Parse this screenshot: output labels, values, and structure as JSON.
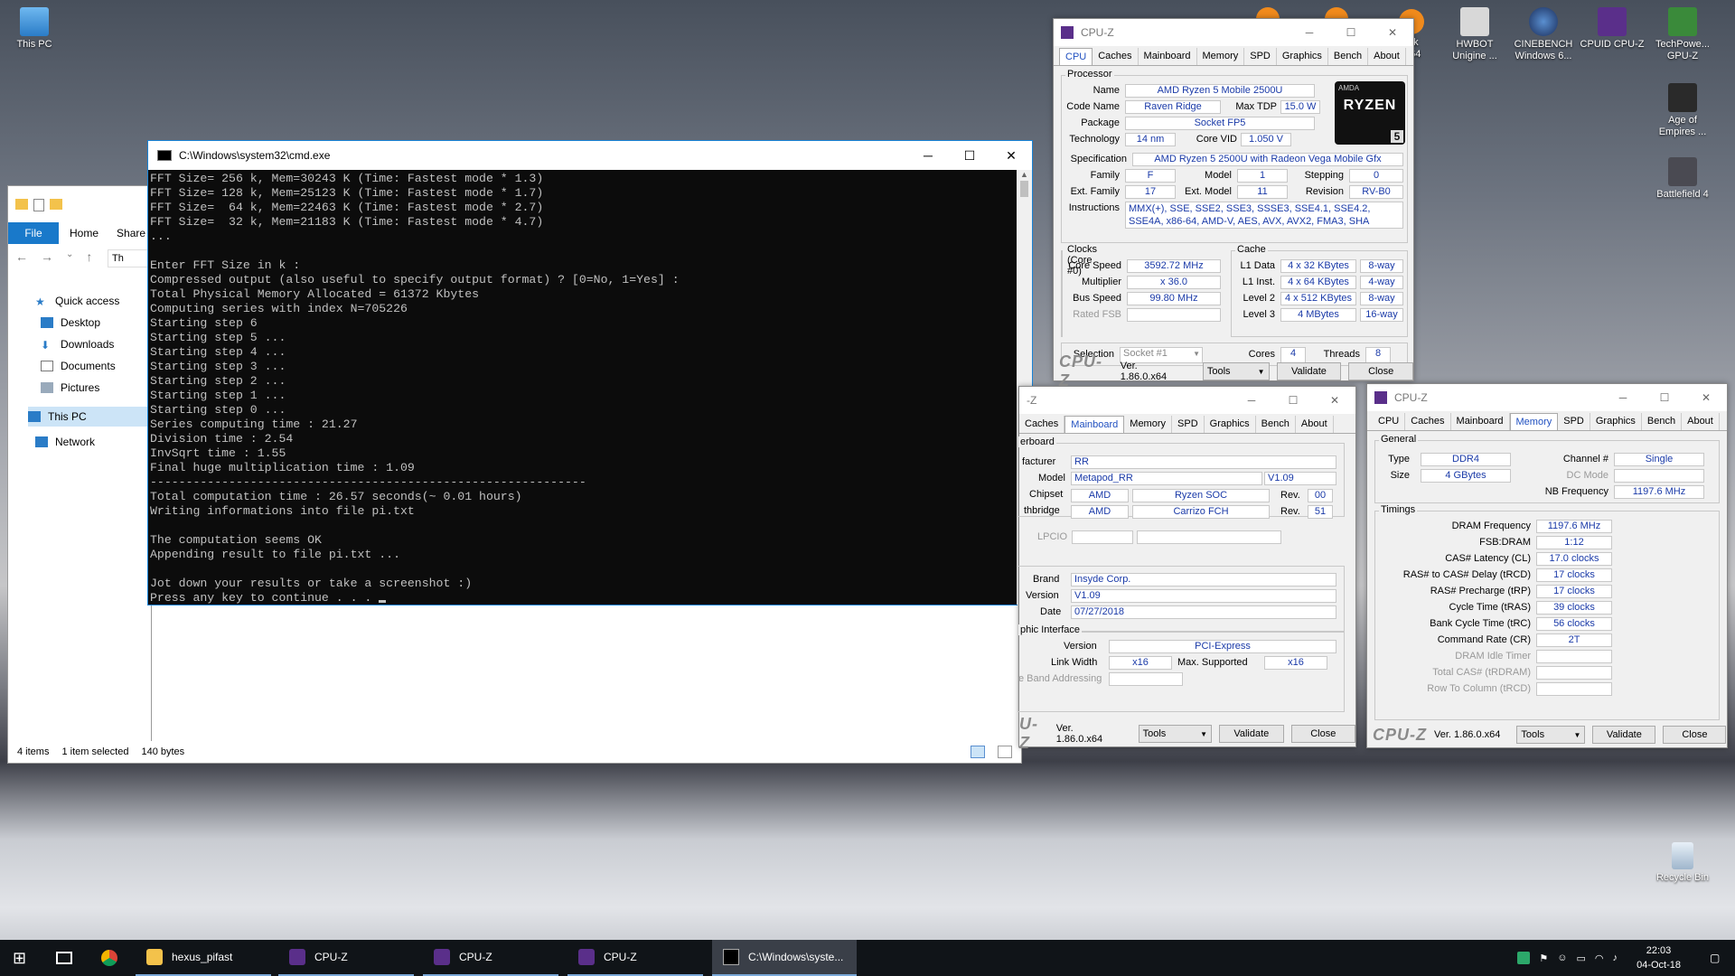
{
  "desktop": {
    "icons_left": [
      {
        "label": "This PC"
      }
    ],
    "icons_right": [
      {
        "label": "ark\n.x64"
      },
      {
        "label": "HWBOT\nUnigine ..."
      },
      {
        "label": "CINEBENCH\nWindows 6..."
      },
      {
        "label": "CPUID CPU-Z"
      },
      {
        "label": "TechPowe...\nGPU-Z"
      },
      {
        "label": "Age of\nEmpires ..."
      },
      {
        "label": "Battlefield 4"
      },
      {
        "label": "Recycle Bin"
      }
    ]
  },
  "explorer": {
    "tab_file": "File",
    "tab_home": "Home",
    "tab_share": "Share",
    "address": "Th",
    "nav": [
      "Quick access",
      "Desktop",
      "Downloads",
      "Documents",
      "Pictures",
      "This PC",
      "Network"
    ],
    "status": {
      "items": "4 items",
      "selected": "1 item selected",
      "size": "140 bytes"
    }
  },
  "cmd": {
    "title": "C:\\Windows\\system32\\cmd.exe",
    "lines": [
      "FFT Size= 256 k, Mem=30243 K (Time: Fastest mode * 1.3)",
      "FFT Size= 128 k, Mem=25123 K (Time: Fastest mode * 1.7)",
      "FFT Size=  64 k, Mem=22463 K (Time: Fastest mode * 2.7)",
      "FFT Size=  32 k, Mem=21183 K (Time: Fastest mode * 4.7)",
      "...",
      "",
      "Enter FFT Size in k :",
      "Compressed output (also useful to specify output format) ? [0=No, 1=Yes] :",
      "Total Physical Memory Allocated = 61372 Kbytes",
      "Computing series with index N=705226",
      "Starting step 6",
      "Starting step 5 ...",
      "Starting step 4 ...",
      "Starting step 3 ...",
      "Starting step 2 ...",
      "Starting step 1 ...",
      "Starting step 0 ...",
      "Series computing time : 21.27",
      "Division time : 2.54",
      "InvSqrt time : 1.55",
      "Final huge multiplication time : 1.09",
      "-------------------------------------------------------------",
      "Total computation time : 26.57 seconds(~ 0.01 hours)",
      "Writing informations into file pi.txt",
      "",
      "The computation seems OK",
      "Appending result to file pi.txt ...",
      "",
      "Jot down your results or take a screenshot :)",
      "Press any key to continue . . . "
    ]
  },
  "cpuz_cpu": {
    "title": "CPU-Z",
    "tabs": [
      "CPU",
      "Caches",
      "Mainboard",
      "Memory",
      "SPD",
      "Graphics",
      "Bench",
      "About"
    ],
    "processor_group": "Processor",
    "name_l": "Name",
    "name": "AMD Ryzen 5 Mobile 2500U",
    "code_name_l": "Code Name",
    "code_name": "Raven Ridge",
    "max_tdp_l": "Max TDP",
    "max_tdp": "15.0 W",
    "package_l": "Package",
    "package": "Socket FP5",
    "technology_l": "Technology",
    "technology": "14 nm",
    "core_vid_l": "Core VID",
    "core_vid": "1.050 V",
    "specification_l": "Specification",
    "specification": "AMD Ryzen 5 2500U with Radeon Vega Mobile Gfx",
    "family_l": "Family",
    "family": "F",
    "model_l": "Model",
    "model": "1",
    "stepping_l": "Stepping",
    "stepping": "0",
    "ext_family_l": "Ext. Family",
    "ext_family": "17",
    "ext_model_l": "Ext. Model",
    "ext_model": "11",
    "revision_l": "Revision",
    "revision": "RV-B0",
    "instructions_l": "Instructions",
    "instructions": "MMX(+), SSE, SSE2, SSE3, SSSE3, SSE4.1, SSE4.2, SSE4A, x86-64, AMD-V, AES, AVX, AVX2, FMA3, SHA",
    "logo_small": "AMDA",
    "logo": "RYZEN",
    "logo_num": "5",
    "clocks_group": "Clocks (Core #0)",
    "core_speed_l": "Core Speed",
    "core_speed": "3592.72 MHz",
    "multiplier_l": "Multiplier",
    "multiplier": "x 36.0",
    "bus_speed_l": "Bus Speed",
    "bus_speed": "99.80 MHz",
    "rated_fsb_l": "Rated FSB",
    "cache_group": "Cache",
    "l1d_l": "L1 Data",
    "l1d": "4 x 32 KBytes",
    "l1d_w": "8-way",
    "l1i_l": "L1 Inst.",
    "l1i": "4 x 64 KBytes",
    "l1i_w": "4-way",
    "l2_l": "Level 2",
    "l2": "4 x 512 KBytes",
    "l2_w": "8-way",
    "l3_l": "Level 3",
    "l3": "4 MBytes",
    "l3_w": "16-way",
    "selection_l": "Selection",
    "selection": "Socket #1",
    "cores_l": "Cores",
    "cores": "4",
    "threads_l": "Threads",
    "threads": "8",
    "logo_text": "CPU-Z",
    "version": "Ver. 1.86.0.x64",
    "tools": "Tools",
    "validate": "Validate",
    "close": "Close"
  },
  "cpuz_mb": {
    "title": "-Z",
    "tabs": [
      "Caches",
      "Mainboard",
      "Memory",
      "SPD",
      "Graphics",
      "Bench",
      "About"
    ],
    "group_mb": "erboard",
    "manufacturer_l": "facturer",
    "manufacturer": "RR",
    "model_l": "Model",
    "model": "Metapod_RR",
    "model_rev": "V1.09",
    "chipset_l": "Chipset",
    "chipset": "AMD",
    "chipset2": "Ryzen SOC",
    "chipset_rev_l": "Rev.",
    "chipset_rev": "00",
    "south_l": "thbridge",
    "south": "AMD",
    "south2": "Carrizo FCH",
    "south_rev_l": "Rev.",
    "south_rev": "51",
    "lpcio_l": "LPCIO",
    "brand_l": "Brand",
    "brand": "Insyde Corp.",
    "version_l": "Version",
    "version_v": "V1.09",
    "date_l": "Date",
    "date": "07/27/2018",
    "group_gi": "phic Interface",
    "gi_version_l": "Version",
    "gi_version": "PCI-Express",
    "link_width_l": "Link Width",
    "link_width": "x16",
    "max_supported_l": "Max. Supported",
    "max_supported": "x16",
    "band_l": "e Band Addressing",
    "logo_text": "U-Z",
    "version": "Ver. 1.86.0.x64",
    "tools": "Tools",
    "validate": "Validate",
    "close": "Close"
  },
  "cpuz_mem": {
    "title": "CPU-Z",
    "tabs": [
      "CPU",
      "Caches",
      "Mainboard",
      "Memory",
      "SPD",
      "Graphics",
      "Bench",
      "About"
    ],
    "general_group": "General",
    "type_l": "Type",
    "type": "DDR4",
    "channel_l": "Channel #",
    "channel": "Single",
    "size_l": "Size",
    "size": "4 GBytes",
    "dc_mode_l": "DC Mode",
    "nb_freq_l": "NB Frequency",
    "nb_freq": "1197.6 MHz",
    "timings_group": "Timings",
    "dram_freq_l": "DRAM Frequency",
    "dram_freq": "1197.6 MHz",
    "fsb_dram_l": "FSB:DRAM",
    "fsb_dram": "1:12",
    "cas_l": "CAS# Latency (CL)",
    "cas": "17.0 clocks",
    "trcd_l": "RAS# to CAS# Delay (tRCD)",
    "trcd": "17 clocks",
    "trp_l": "RAS# Precharge (tRP)",
    "trp": "17 clocks",
    "tras_l": "Cycle Time (tRAS)",
    "tras": "39 clocks",
    "trc_l": "Bank Cycle Time (tRC)",
    "trc": "56 clocks",
    "cr_l": "Command Rate (CR)",
    "cr": "2T",
    "idle_l": "DRAM Idle Timer",
    "total_cas_l": "Total CAS# (tRDRAM)",
    "row_col_l": "Row To Column (tRCD)",
    "logo_text": "CPU-Z",
    "version": "Ver. 1.86.0.x64",
    "tools": "Tools",
    "validate": "Validate",
    "close": "Close"
  },
  "taskbar": {
    "items": [
      "hexus_pifast",
      "CPU-Z",
      "CPU-Z",
      "CPU-Z",
      "C:\\Windows\\syste..."
    ],
    "time": "22:03",
    "date": "04-Oct-18"
  }
}
